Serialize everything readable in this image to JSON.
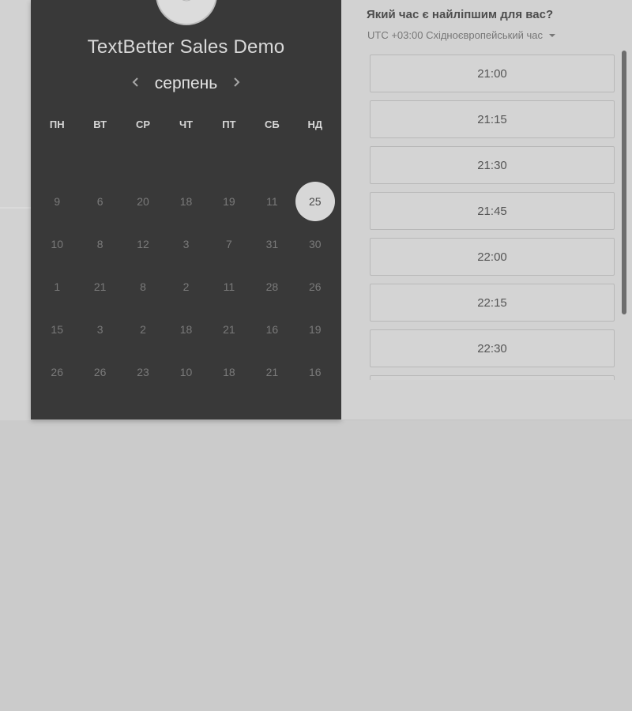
{
  "scheduler": {
    "title": "TextBetter Sales Demo",
    "month": "серпень",
    "weekdays": [
      "ПН",
      "ВТ",
      "СР",
      "ЧТ",
      "ПТ",
      "СБ",
      "НД"
    ],
    "days": [
      [
        "9",
        "6",
        "20",
        "18",
        "19",
        "11",
        "25"
      ],
      [
        "10",
        "8",
        "12",
        "3",
        "7",
        "31",
        "30"
      ],
      [
        "1",
        "21",
        "8",
        "2",
        "11",
        "28",
        "26"
      ],
      [
        "15",
        "3",
        "2",
        "18",
        "21",
        "16",
        "19"
      ],
      [
        "26",
        "26",
        "23",
        "10",
        "18",
        "21",
        "16"
      ]
    ],
    "selected_day": "25"
  },
  "time_picker": {
    "question": "Який час є найліпшим для вас?",
    "timezone": "UTC +03:00 Східноєвропейський час",
    "slots": [
      "21:00",
      "21:15",
      "21:30",
      "21:45",
      "22:00",
      "22:15",
      "22:30",
      ""
    ]
  }
}
